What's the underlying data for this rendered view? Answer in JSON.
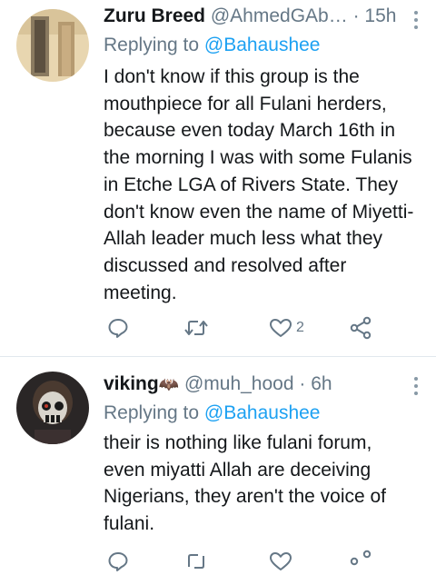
{
  "tweets": [
    {
      "name": "Zuru Breed",
      "handle": "@AhmedGAb…",
      "time": "· 15h",
      "replying_prefix": "Replying to ",
      "replying_to": "@Bahaushee",
      "text": "I don't know if this group is the mouthpiece for all Fulani herders, because even today March 16th in the morning I was with some Fulanis in Etche LGA of Rivers State. They don't know even the name of Miyetti-Allah leader much less what they discussed and resolved after meeting.",
      "likes": "2"
    },
    {
      "name": "viking",
      "name_emoji": "🦇",
      "handle": "@muh_hood",
      "time": "· 6h",
      "replying_prefix": "Replying to ",
      "replying_to": "@Bahaushee",
      "text": "their is nothing like fulani forum, even miyatti Allah are deceiving Nigerians, they aren't the voice of fulani."
    }
  ],
  "colors": {
    "link": "#1da1f2",
    "secondary": "#657786",
    "icon": "#8899a6",
    "divider": "#e1e8ed"
  },
  "icons": [
    "reply-icon",
    "retweet-icon",
    "like-icon",
    "share-icon",
    "more-options-icon"
  ]
}
